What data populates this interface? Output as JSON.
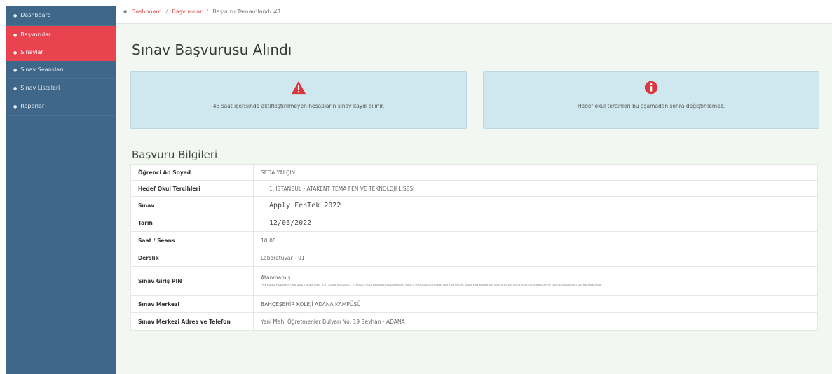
{
  "sidebar": {
    "items": [
      {
        "label": "Dashboard",
        "active": false
      },
      {
        "label": "Başvurular",
        "active": true
      },
      {
        "label": "Sınavlar",
        "active": true
      },
      {
        "label": "Sınav Seansları",
        "active": false
      },
      {
        "label": "Sınav Listeleri",
        "active": false
      },
      {
        "label": "Raporlar",
        "active": false
      }
    ]
  },
  "breadcrumb": {
    "home": "Dashboard",
    "section": "Başvurular",
    "current": "Başvuru Tamamlandı #1",
    "separator": "/"
  },
  "page": {
    "title": "Sınav Başvurusu Alındı"
  },
  "alerts": {
    "warning": {
      "icon": "warning-triangle-icon",
      "text": "48 saat içerisinde aktifleştirilmeyen hesapların sınav kaydı silinir."
    },
    "info": {
      "icon": "info-circle-icon",
      "text": "Hedef okul tercihleri bu aşamadan sonra değiştirilemez."
    }
  },
  "info": {
    "title": "Başvuru Bilgileri",
    "rows": [
      {
        "label": "Öğrenci Ad Soyad",
        "value": "SEDA YALÇIN"
      },
      {
        "label": "Hedef Okul Tercihleri",
        "value": "1. İSTANBUL - ATAKENT TEMA FEN VE TEKNOLOJİ LİSESİ"
      },
      {
        "label": "Sınav",
        "value": "Apply FenTek 2022"
      },
      {
        "label": "Tarih",
        "value": "12/03/2022"
      },
      {
        "label": "Saat / Seans",
        "value": "10:00"
      },
      {
        "label": "Derslik",
        "value": "Laboratuvar - 01"
      },
      {
        "label": "Sınav Giriş PIN",
        "value": "Atanmamış.",
        "note": "PIN kodu ApplyFenTek 2021 sıdo giriş için kullanılacaktır. E-Posta doğrulaması yapıldıktan sonra e-posta adresine gönderilecek olan PIN kodunun sınav güvenliği nedeniyle kimseyle paylaşılmaması gerekmektedir."
      },
      {
        "label": "Sınav Merkezi",
        "value": "BAHÇEŞEHİR KOLEJİ ADANA KAMPÜSÜ"
      },
      {
        "label": "Sınav Merkezi Adres ve Telefon",
        "value": "Yeni Mah. Öğretmenler Bulvarı No: 19 Seyhan - ADANA"
      }
    ]
  },
  "colors": {
    "sidebar": "#3f6789",
    "active": "#e8434e",
    "alert_bg": "#cfe7ee",
    "warning_icon": "#d9363e",
    "info_icon": "#d9363e"
  }
}
